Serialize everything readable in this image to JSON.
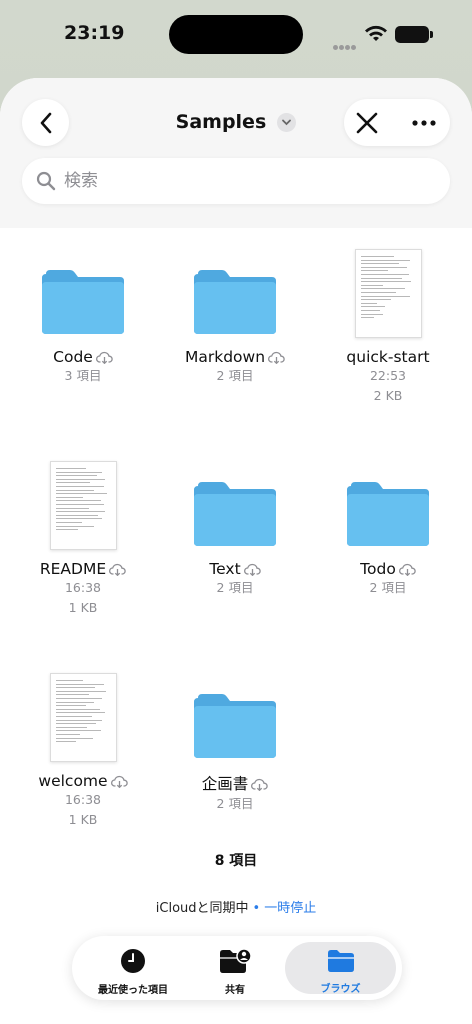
{
  "status_bar": {
    "time": "23:19"
  },
  "nav": {
    "title": "Samples"
  },
  "search": {
    "placeholder": "検索"
  },
  "items": [
    {
      "name": "Code",
      "kind": "folder",
      "line1": "3 項目",
      "line2": ""
    },
    {
      "name": "Markdown",
      "kind": "folder",
      "line1": "2 項目",
      "line2": ""
    },
    {
      "name": "quick-start",
      "kind": "document",
      "line1": "22:53",
      "line2": "2 KB"
    },
    {
      "name": "README",
      "kind": "document",
      "line1": "16:38",
      "line2": "1 KB"
    },
    {
      "name": "Text",
      "kind": "folder",
      "line1": "2 項目",
      "line2": ""
    },
    {
      "name": "Todo",
      "kind": "folder",
      "line1": "2 項目",
      "line2": ""
    },
    {
      "name": "welcome",
      "kind": "document",
      "line1": "16:38",
      "line2": "1 KB"
    },
    {
      "name": "企画書",
      "kind": "folder",
      "line1": "2 項目",
      "line2": ""
    }
  ],
  "summary": "8 項目",
  "sync": {
    "text": "iCloudと同期中",
    "separator": "•",
    "action": "一時停止"
  },
  "tabbar": {
    "recent": "最近使った項目",
    "shared": "共有",
    "browse": "ブラウズ"
  },
  "colors": {
    "accent": "#1f7ae0",
    "folder": "#5cb8ec"
  }
}
